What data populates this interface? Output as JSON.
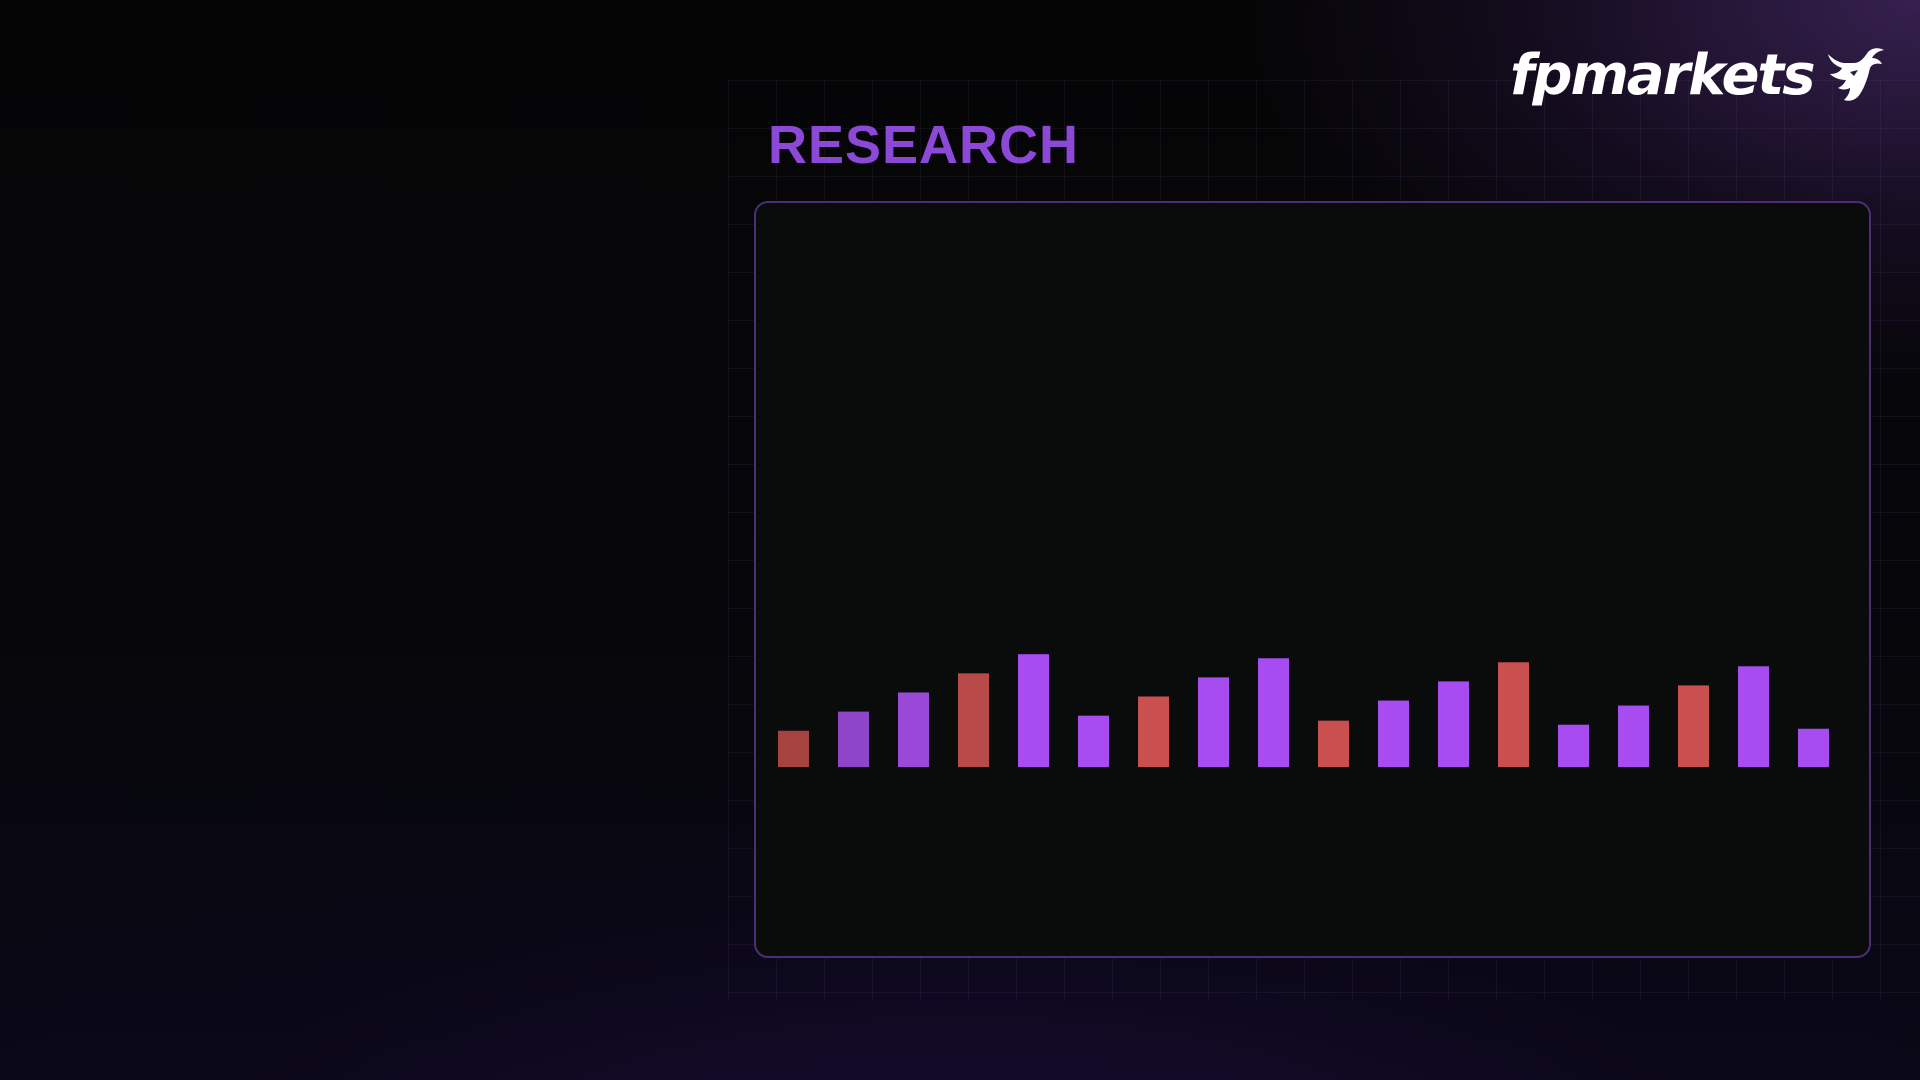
{
  "brand": {
    "name": "fpmarkets",
    "icon": "bull-head-icon"
  },
  "header": {
    "title": "RESEARCH"
  },
  "colors": {
    "accent": "#8c48d6",
    "bar_up": "#a64cf0",
    "bar_down": "#c9504e",
    "panel_bg": "#0a0b0b",
    "panel_border": "#4a2f78"
  },
  "chart_data": {
    "type": "bar",
    "title": "",
    "xlabel": "",
    "ylabel": "",
    "grid": false,
    "legend": "none",
    "categories": [
      "",
      "",
      "",
      "",
      "",
      "",
      "",
      "",
      "",
      "",
      "",
      "",
      "",
      "",
      "",
      "",
      "",
      ""
    ],
    "values": [
      36,
      55,
      74,
      93,
      112,
      51,
      70,
      89,
      108,
      46,
      66,
      85,
      104,
      42,
      61,
      81,
      100,
      38
    ],
    "colors": [
      "#a4433f",
      "#8e45c9",
      "#9a48d8",
      "#b84b49",
      "#a64cf0",
      "#a64cf0",
      "#c9504e",
      "#a64cf0",
      "#a64cf0",
      "#c9504e",
      "#a64cf0",
      "#a64cf0",
      "#c9504e",
      "#a64cf0",
      "#a64cf0",
      "#c9504e",
      "#a64cf0",
      "#a64cf0"
    ],
    "ylim": [
      0,
      560
    ]
  }
}
